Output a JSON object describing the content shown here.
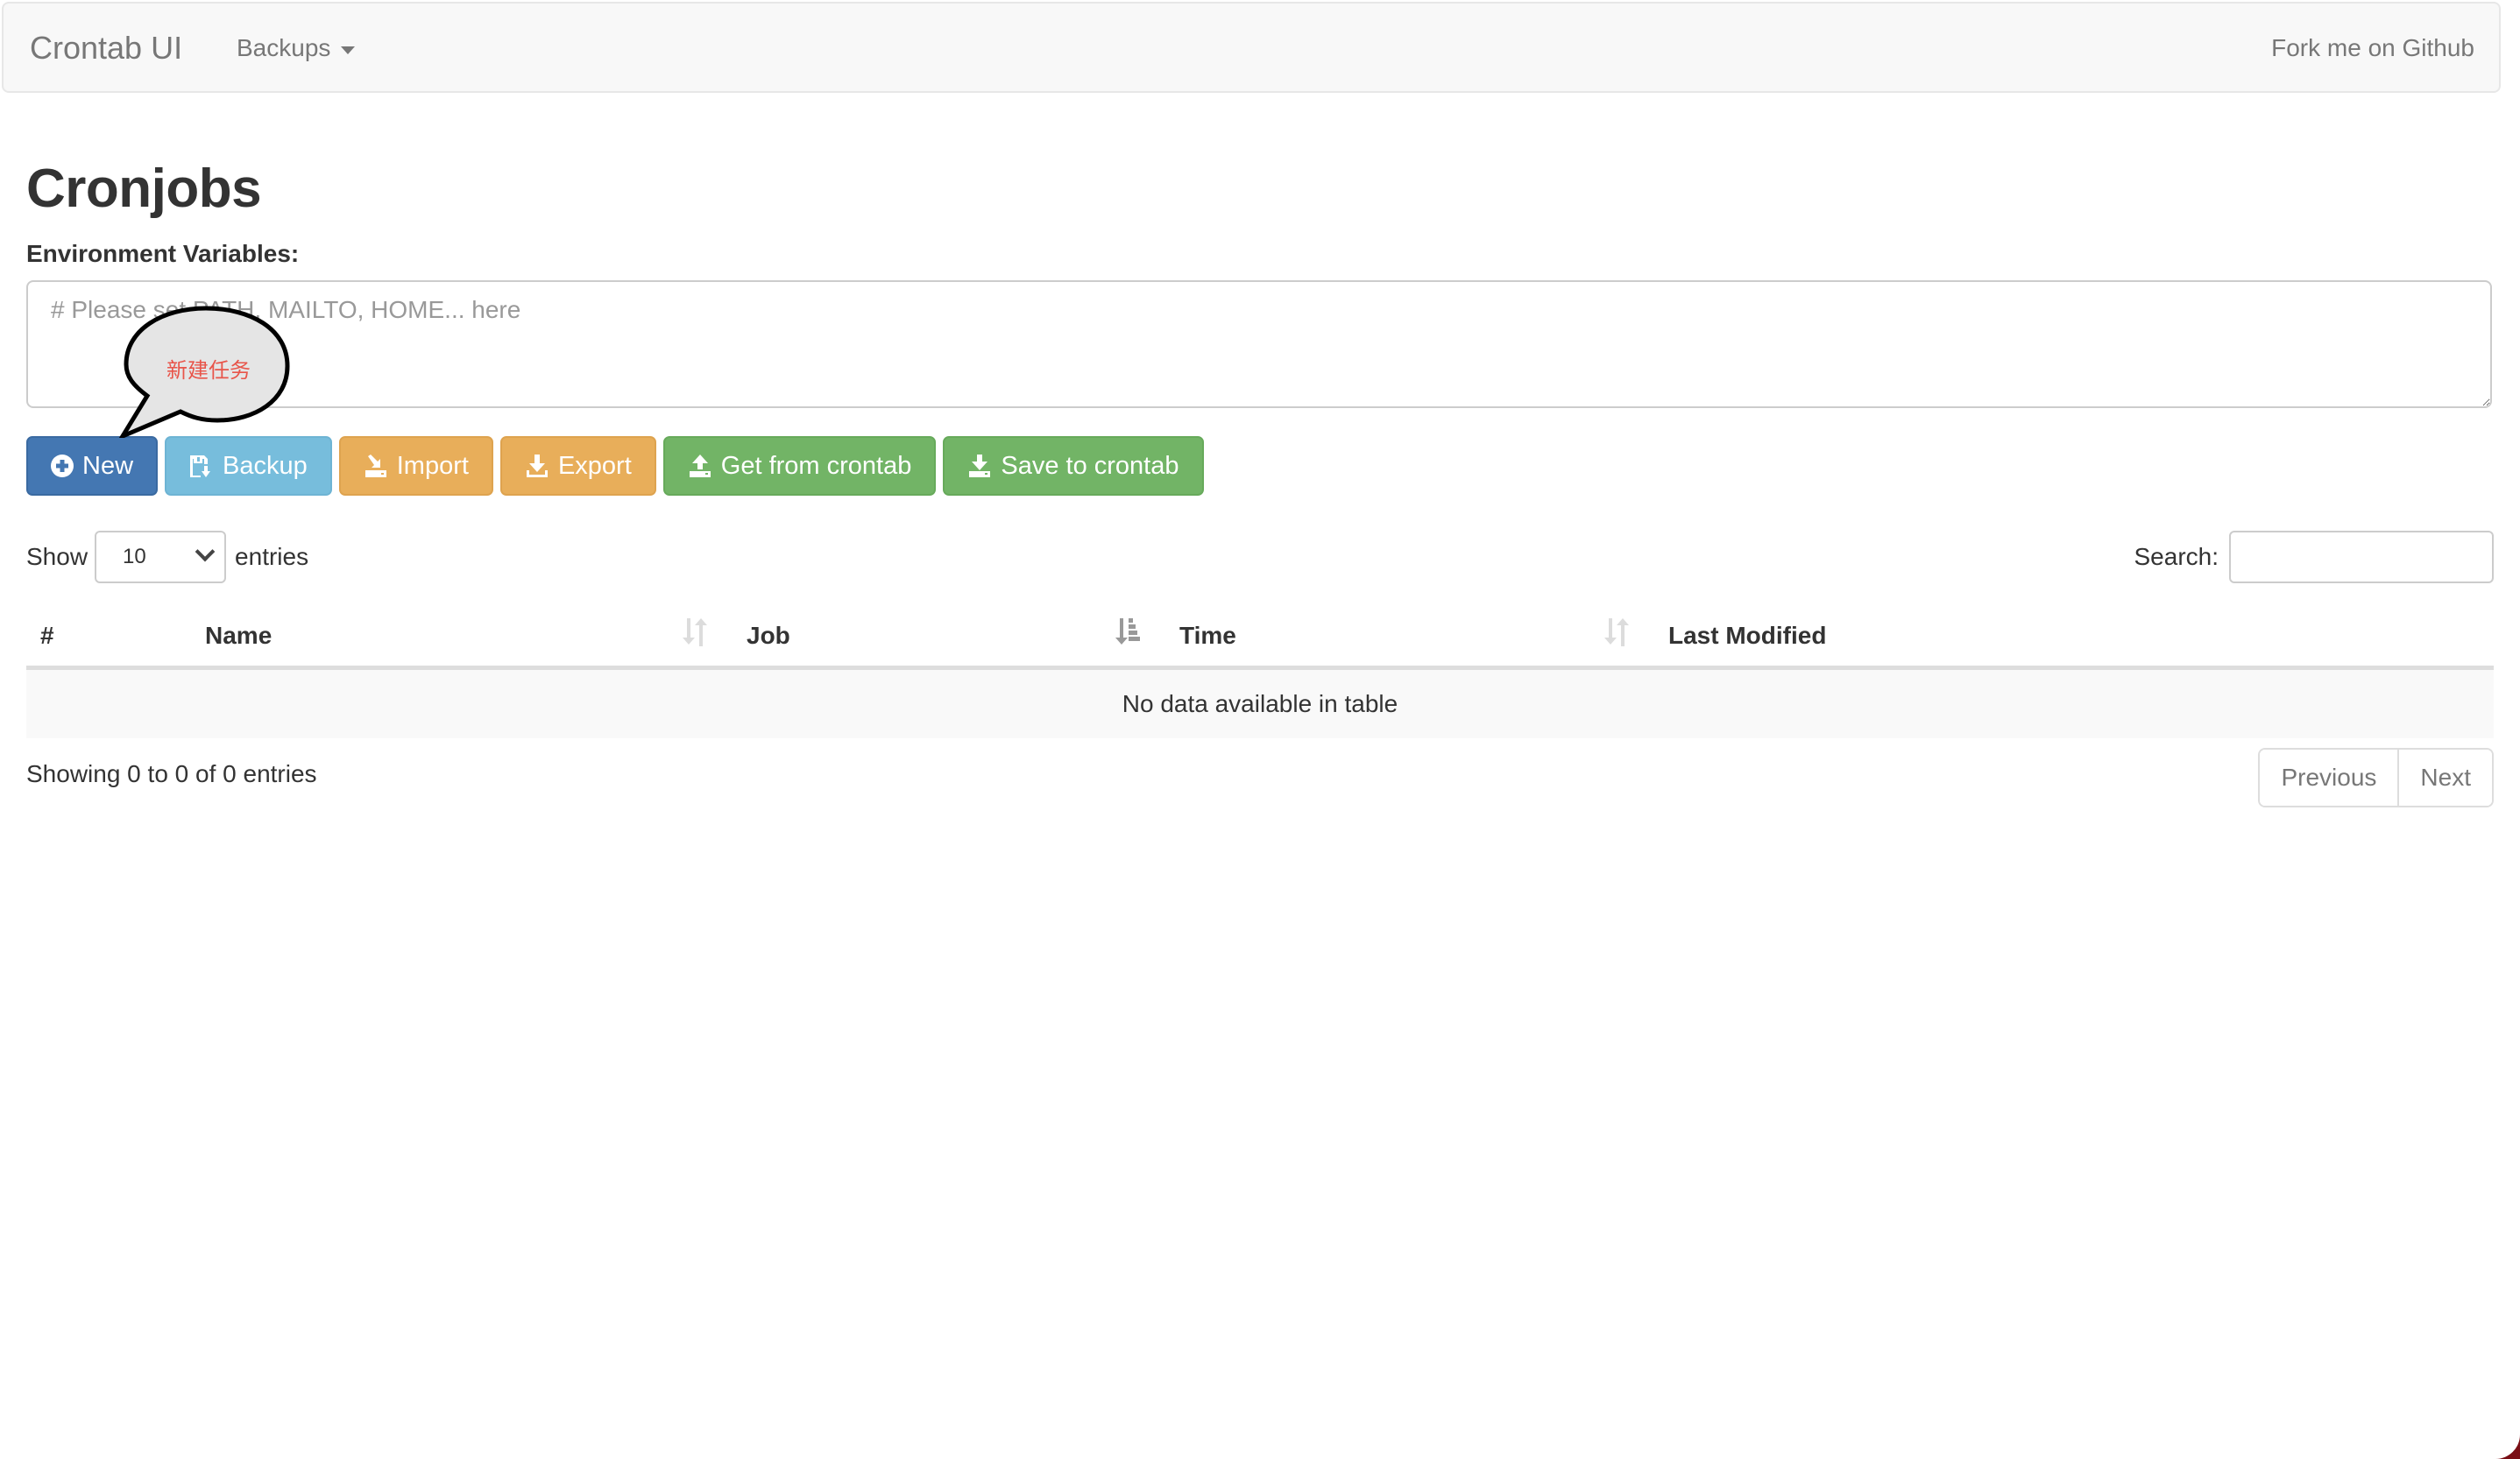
{
  "navbar": {
    "brand": "Crontab UI",
    "dropdown_label": "Backups",
    "right_link": "Fork me on Github"
  },
  "page": {
    "title": "Cronjobs",
    "env_label": "Environment Variables:",
    "env_placeholder": "# Please set PATH, MAILTO, HOME... here",
    "env_value": ""
  },
  "tooltip": {
    "text": "新建任务"
  },
  "toolbar": {
    "buttons": [
      {
        "label": "New",
        "icon": "plus-circle-icon",
        "color": "#4477b2"
      },
      {
        "label": "Backup",
        "icon": "floppy-disk-icon",
        "color": "#77bddc"
      },
      {
        "label": "Import",
        "icon": "import-icon",
        "color": "#e8ae5a"
      },
      {
        "label": "Export",
        "icon": "download-icon",
        "color": "#e8ae5a"
      },
      {
        "label": "Get from crontab",
        "icon": "upload-icon",
        "color": "#72b466"
      },
      {
        "label": "Save to crontab",
        "icon": "download-icon",
        "color": "#72b466"
      }
    ]
  },
  "table_controls": {
    "show_label": "Show",
    "entries_label": "entries",
    "page_length": "10",
    "search_label": "Search:",
    "search_value": ""
  },
  "table": {
    "columns": [
      {
        "label": "#",
        "sort": "none"
      },
      {
        "label": "Name",
        "sort": "both"
      },
      {
        "label": "Job",
        "sort": "both"
      },
      {
        "label": "Time",
        "sort": "descending"
      },
      {
        "label": "Last Modified",
        "sort": "both"
      }
    ],
    "empty_message": "No data available in table",
    "rows": []
  },
  "footer": {
    "info": "Showing 0 to 0 of 0 entries",
    "previous": "Previous",
    "next": "Next"
  }
}
